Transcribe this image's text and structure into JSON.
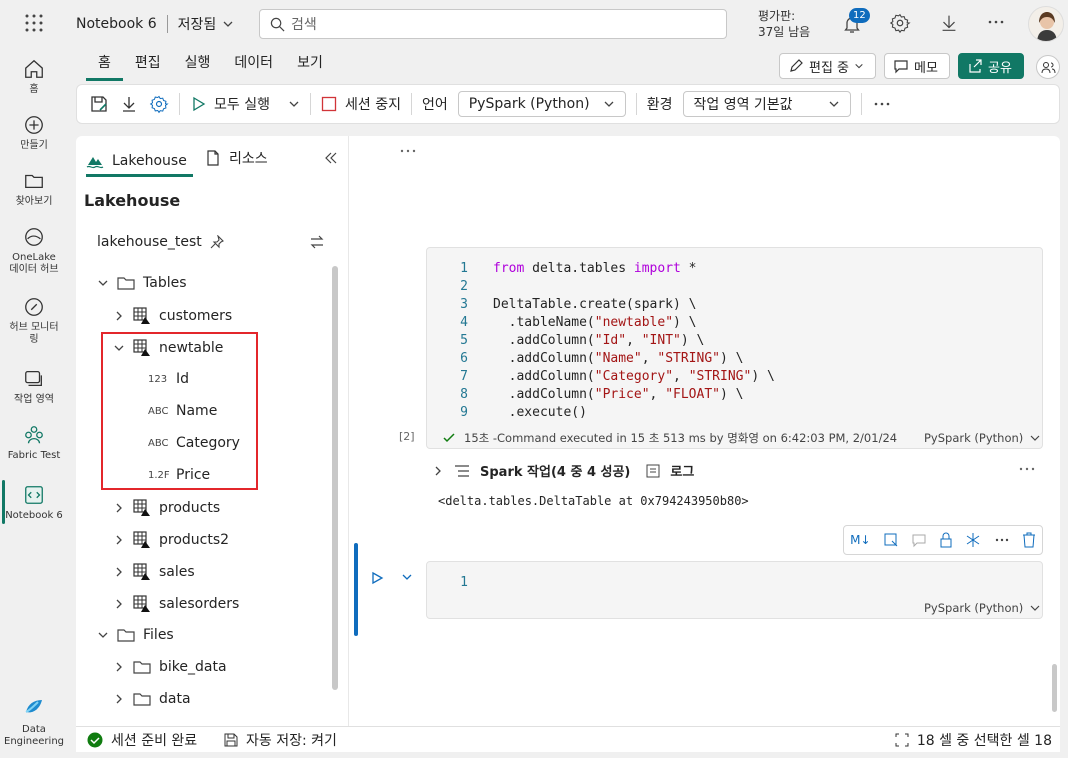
{
  "header": {
    "notebook_name": "Notebook 6",
    "save_state": "저장됨",
    "search_placeholder": "검색",
    "trial_label": "평가판:",
    "trial_days": "37일 남음",
    "notification_count": "12"
  },
  "leftnav": {
    "items": [
      {
        "label": "홈",
        "icon": "home-icon"
      },
      {
        "label": "만들기",
        "icon": "create-icon"
      },
      {
        "label": "찾아보기",
        "icon": "browse-icon"
      },
      {
        "label": "OneLake 데이터 허브",
        "icon": "onelake-icon"
      },
      {
        "label": "허브 모니터링",
        "icon": "monitor-icon"
      },
      {
        "label": "작업 영역",
        "icon": "workspaces-icon"
      },
      {
        "label": "Fabric Test",
        "icon": "workspace-icon"
      },
      {
        "label": "Notebook 6",
        "icon": "notebook-icon"
      }
    ],
    "bottom": {
      "label": "Data Engineering",
      "icon": "data-engineering-icon"
    }
  },
  "ribbon": {
    "tabs": [
      "홈",
      "편집",
      "실행",
      "데이터",
      "보기"
    ],
    "active_tab": "홈",
    "editing_label": "편집 중",
    "comment_label": "메모",
    "share_label": "공유",
    "run_all_label": "모두 실행",
    "stop_session_label": "세션 중지",
    "language_label": "언어",
    "language_value": "PySpark (Python)",
    "environment_label": "환경",
    "environment_value": "작업 영역 기본값",
    "accent_color": "#117865"
  },
  "explorer": {
    "tab_lakehouse": "Lakehouse",
    "tab_resources": "리소스",
    "heading": "Lakehouse",
    "lakehouse_name": "lakehouse_test",
    "tables_label": "Tables",
    "tables": [
      {
        "name": "customers",
        "expanded": false
      },
      {
        "name": "newtable",
        "expanded": true,
        "columns": [
          {
            "type": "123",
            "name": "Id"
          },
          {
            "type": "ABC",
            "name": "Name"
          },
          {
            "type": "ABC",
            "name": "Category"
          },
          {
            "type": "1.2F",
            "name": "Price"
          }
        ]
      },
      {
        "name": "products",
        "expanded": false
      },
      {
        "name": "products2",
        "expanded": false
      },
      {
        "name": "sales",
        "expanded": false
      },
      {
        "name": "salesorders",
        "expanded": false
      }
    ],
    "files_label": "Files",
    "files": [
      "bike_data",
      "data"
    ]
  },
  "notebook": {
    "cell1": {
      "lines": [
        "from delta.tables import *",
        "",
        "DeltaTable.create(spark) \\",
        "  .tableName(\"newtable\") \\",
        "  .addColumn(\"Id\", \"INT\") \\",
        "  .addColumn(\"Name\", \"STRING\") \\",
        "  .addColumn(\"Category\", \"STRING\") \\",
        "  .addColumn(\"Price\", \"FLOAT\") \\",
        "  .execute()"
      ],
      "exec_count": "[2]",
      "status": "15초 -Command executed in 15 초 513 ms by 명화영 on 6:42:03 PM, 2/01/24",
      "language": "PySpark (Python)",
      "spark_jobs": "Spark 작업(4 중 4 성공)",
      "log_label": "로그",
      "output": "<delta.tables.DeltaTable at 0x794243950b80>"
    },
    "cell2": {
      "line_number": "1",
      "language": "PySpark (Python)"
    }
  },
  "statusbar": {
    "session": "세션 준비 완료",
    "autosave": "자동 저장: 켜기",
    "selection": "18 셀 중 선택한 셀 18"
  }
}
